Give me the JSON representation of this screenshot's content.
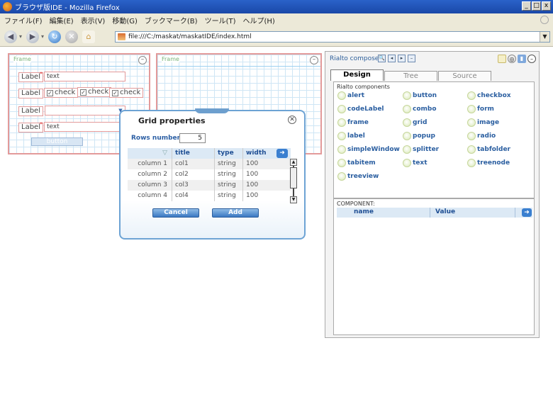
{
  "window": {
    "title": "ブラウザ版IDE - Mozilla Firefox",
    "min": "_",
    "max": "□",
    "close": "x"
  },
  "menu": [
    "ファイル(F)",
    "編集(E)",
    "表示(V)",
    "移動(G)",
    "ブックマーク(B)",
    "ツール(T)",
    "ヘルプ(H)"
  ],
  "nav": {
    "url": "file:///C:/maskat/maskatIDE/index.html"
  },
  "canvas": {
    "frame1": {
      "title": "Frame",
      "labels": [
        "Label",
        "Label",
        "Label",
        "Label"
      ],
      "text1": "text",
      "text2": "text",
      "checks": [
        "check",
        "check",
        "check"
      ],
      "button": "button"
    },
    "frame2": {
      "title": "Frame"
    }
  },
  "dialog": {
    "title": "Grid properties",
    "rows_label": "Rows number",
    "rows_value": "5",
    "columns": [
      "title",
      "type",
      "width"
    ],
    "rows": [
      [
        "column 1",
        "col1",
        "string",
        "100"
      ],
      [
        "column 2",
        "col2",
        "string",
        "100"
      ],
      [
        "column 3",
        "col3",
        "string",
        "100"
      ],
      [
        "column 4",
        "col4",
        "string",
        "100"
      ]
    ],
    "cancel": "Cancel",
    "add": "Add"
  },
  "composer": {
    "title": "Rialto composer",
    "tabs": [
      "Design",
      "Tree",
      "Source"
    ],
    "components_title": "Rialto components",
    "components": [
      "alert",
      "button",
      "checkbox",
      "codeLabel",
      "combo",
      "form",
      "frame",
      "grid",
      "image",
      "label",
      "popup",
      "radio",
      "simpleWindow",
      "splitter",
      "tabfolder",
      "tabitem",
      "text",
      "treenode",
      "treeview"
    ],
    "props_title": "COMPONENT:",
    "props_name": "name",
    "props_value": "Value"
  }
}
